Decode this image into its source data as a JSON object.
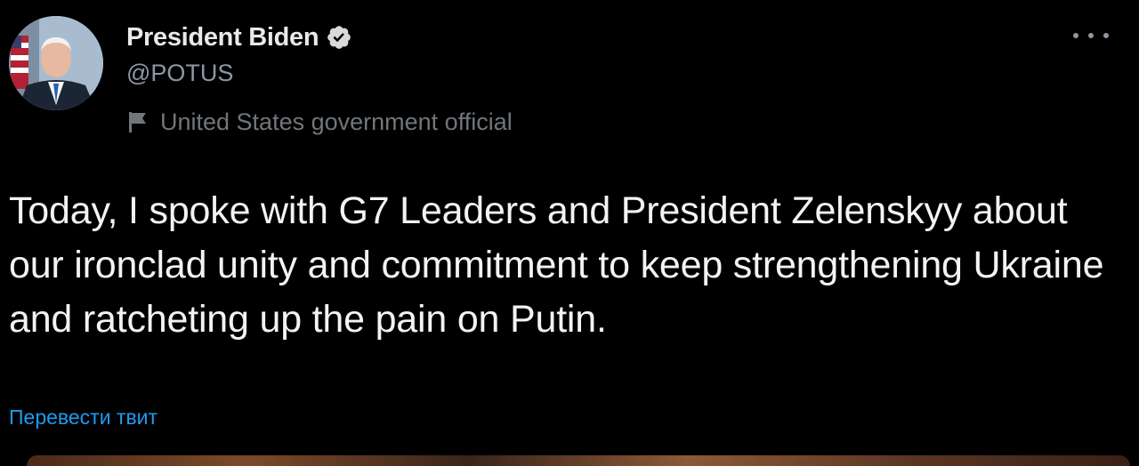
{
  "author": {
    "display_name": "President Biden",
    "handle": "@POTUS",
    "label": "United States government official",
    "verified": true,
    "avatar_icon": "portrait-avatar"
  },
  "tweet": {
    "text": "Today, I spoke with G7 Leaders and President Zelenskyy about our ironclad unity and commitment to keep strengthening Ukraine and ratcheting up the pain on Putin.",
    "translate_label": "Перевести твит"
  },
  "icons": {
    "verified": "verified-badge-icon",
    "official": "flag-icon",
    "more": "more-options-icon"
  },
  "colors": {
    "background": "#000000",
    "text": "#e7e9ea",
    "secondary": "#71767b",
    "link": "#1d9bf0"
  }
}
